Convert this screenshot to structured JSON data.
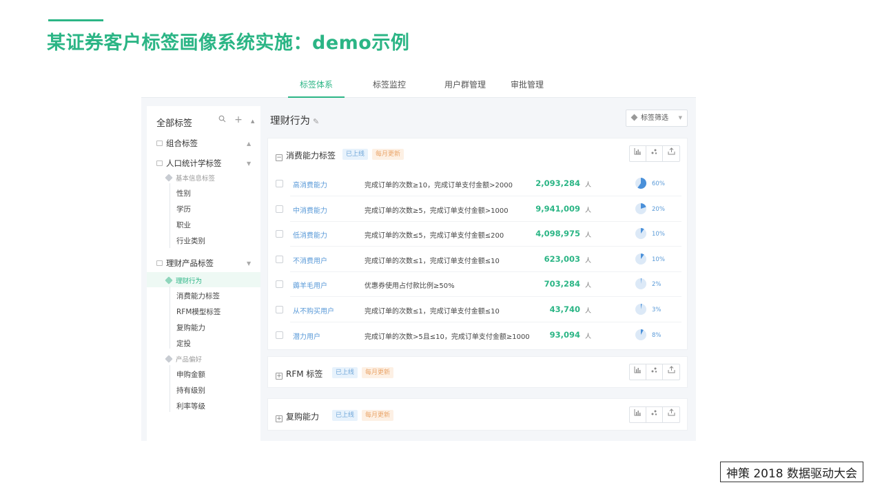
{
  "slide": {
    "title": "某证券客户标签画像系统实施：demo示例",
    "footer": "神策 2018 数据驱动大会"
  },
  "nav": {
    "tabs": [
      {
        "label": "标签体系",
        "active": true
      },
      {
        "label": "标签监控",
        "active": false
      },
      {
        "label": "用户群管理",
        "active": false
      },
      {
        "label": "审批管理",
        "active": false
      }
    ]
  },
  "sidebar": {
    "header": "全部标签",
    "tools": {
      "search_icon": "search-icon",
      "add_icon": "plus-icon",
      "collapse_icon": "caret-up-icon"
    },
    "groups": [
      {
        "label": "组合标签",
        "caret": "▲"
      },
      {
        "label": "人口统计学标签",
        "caret": "▼",
        "sub": "基本信息标签",
        "leaves": [
          "性别",
          "学历",
          "职业",
          "行业类别"
        ]
      },
      {
        "label": "理财产品标签",
        "caret": "▼",
        "sub_active": "理财行为",
        "leaves_a": [
          "消费能力标签",
          "RFM模型标签",
          "复购能力",
          "定投"
        ],
        "sub2": "产品偏好",
        "leaves_b": [
          "申购金额",
          "持有级别",
          "利率等级"
        ]
      }
    ]
  },
  "main": {
    "page_title": "理财行为",
    "filter_label": "标签筛选",
    "badge_online": "已上线",
    "badge_monthly": "每月更新",
    "cards": [
      {
        "title": "消费能力标签",
        "expanded": true,
        "rows": [
          {
            "name": "高消费能力",
            "rule": "完成订单的次数≥10，完成订单支付金额>2000",
            "count": "2,093,284",
            "unit": "人",
            "pct_label": "60%",
            "fraction": 0.6
          },
          {
            "name": "中消费能力",
            "rule": "完成订单的次数≥5，完成订单支付金额>1000",
            "count": "9,941,009",
            "unit": "人",
            "pct_label": "20%",
            "fraction": 0.2
          },
          {
            "name": "低消费能力",
            "rule": "完成订单的次数≤5，完成订单支付金额≤200",
            "count": "4,098,975",
            "unit": "人",
            "pct_label": "10%",
            "fraction": 0.1
          },
          {
            "name": "不消费用户",
            "rule": "完成订单的次数≤1，完成订单支付金额≤10",
            "count": "623,003",
            "unit": "人",
            "pct_label": "10%",
            "fraction": 0.1
          },
          {
            "name": "薅羊毛用户",
            "rule": "优惠券使用占付款比例≥50%",
            "count": "703,284",
            "unit": "人",
            "pct_label": "2%",
            "fraction": 0.02
          },
          {
            "name": "从不购买用户",
            "rule": "完成订单的次数≤1，完成订单支付金额≤10",
            "count": "43,740",
            "unit": "人",
            "pct_label": "3%",
            "fraction": 0.03
          },
          {
            "name": "潜力用户",
            "rule": "完成订单的次数>5且≤10，完成订单支付金额≥1000",
            "count": "93,094",
            "unit": "人",
            "pct_label": "8%",
            "fraction": 0.08
          }
        ]
      },
      {
        "title": "RFM 标签",
        "expanded": false
      },
      {
        "title": "复购能力",
        "expanded": false
      }
    ],
    "action_icons": [
      "bar-chart-icon",
      "scatter-icon",
      "export-icon"
    ],
    "colors": {
      "accent": "#2bb585",
      "link": "#5a9ad8",
      "pie": "#4a90d9",
      "pie_bg": "#dce9f7"
    }
  }
}
